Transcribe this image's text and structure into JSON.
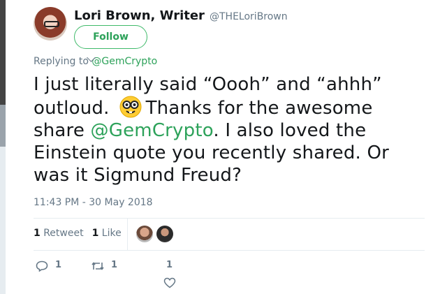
{
  "author": {
    "name": "Lori Brown, Writer",
    "handle": "@THELoriBrown",
    "follow_label": "Follow"
  },
  "reply": {
    "prefix": "Replying to",
    "to": "@GemCrypto"
  },
  "tweet": {
    "part1": "I just literally said “Oooh” and “ahhh” outloud.",
    "emoji": "nerd-face",
    "part2": "Thanks for the awesome share ",
    "mention": "@GemCrypto",
    "part3": ".  I also loved the Einstein quote you recently shared. Or was it Sigmund Freud?"
  },
  "timestamp": "11:43 PM - 30 May 2018",
  "stats": {
    "retweets": "1",
    "retweet_label": "Retweet",
    "likes": "1",
    "like_label": "Like"
  },
  "actions": {
    "reply_count": "1",
    "retweet_count": "1",
    "like_count": "1"
  },
  "colors": {
    "accent": "#2da25a",
    "muted": "#657786",
    "text": "#14171a"
  }
}
